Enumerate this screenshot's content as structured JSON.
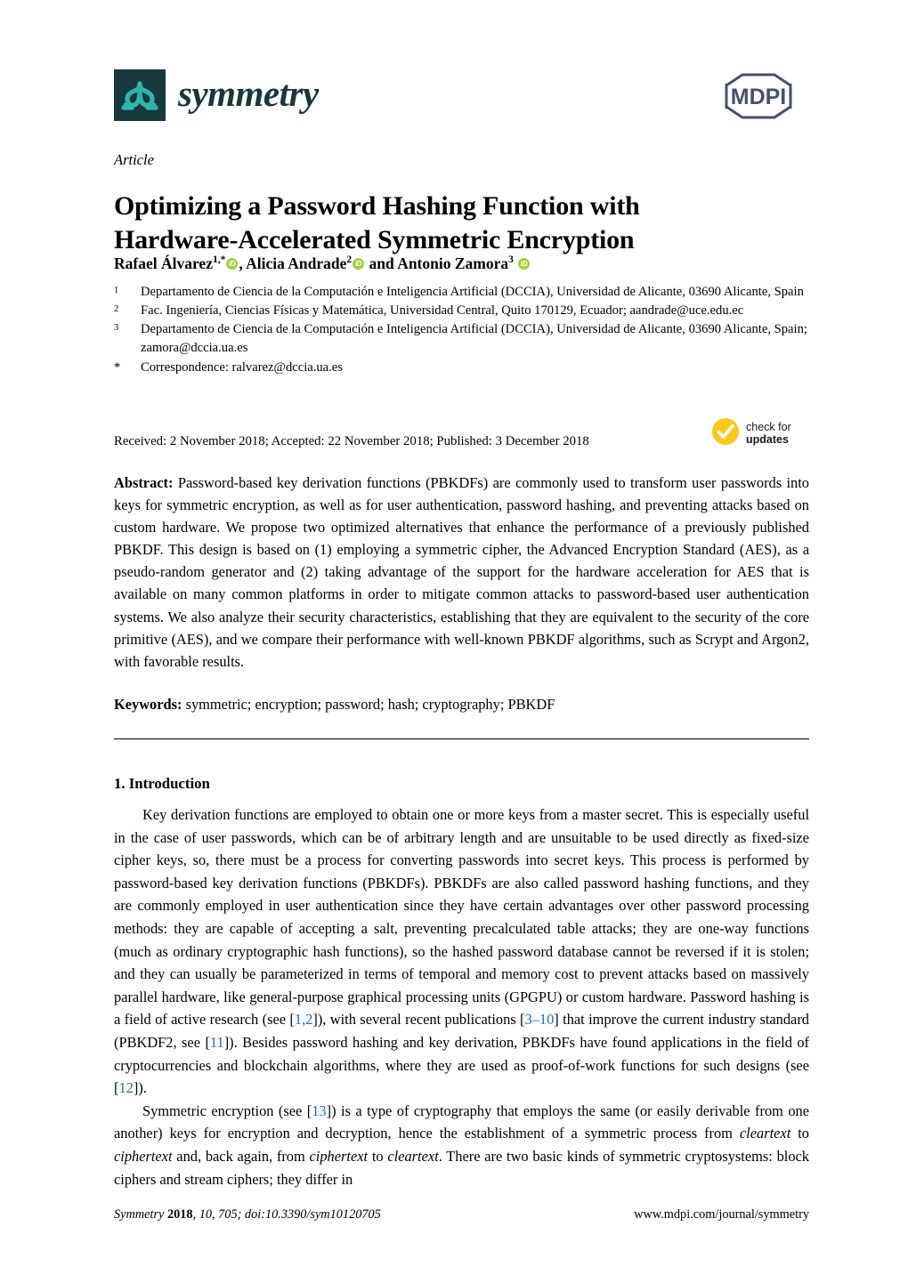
{
  "journal": {
    "name": "symmetry",
    "logo_icon": "symmetry-logo-icon",
    "publisher_logo_text": "MDPI",
    "logo_colors": {
      "box": "#17393d",
      "glyph": "#2eb5ad",
      "mdpi": "#46506e"
    }
  },
  "article": {
    "type": "Article",
    "title": "Optimizing a Password Hashing Function with Hardware-Accelerated Symmetric Encryption"
  },
  "authors": {
    "list": [
      {
        "name": "Rafael Álvarez",
        "markers": "1,*",
        "orcid": "iD"
      },
      {
        "name": "Alicia Andrade",
        "markers": "2",
        "orcid": "iD"
      },
      {
        "name": "Antonio Zamora",
        "markers": "3",
        "orcid": "iD"
      }
    ],
    "conjunction": "and",
    "separator": ", "
  },
  "affiliations": [
    {
      "marker": "1",
      "text": "Departamento de Ciencia de la Computación e Inteligencia Artificial (DCCIA), Universidad de Alicante, 03690 Alicante, Spain"
    },
    {
      "marker": "2",
      "text": "Fac. Ingeniería, Ciencias Físicas y Matemática, Universidad Central, Quito 170129, Ecuador; aandrade@uce.edu.ec"
    },
    {
      "marker": "3",
      "text": "Departamento de Ciencia de la Computación e Inteligencia Artificial (DCCIA), Universidad de Alicante, 03690 Alicante, Spain; zamora@dccia.ua.es"
    },
    {
      "marker": "*",
      "text": "Correspondence: ralvarez@dccia.ua.es"
    }
  ],
  "dates": {
    "line": "Received: 2 November 2018; Accepted: 22 November 2018; Published: 3 December 2018"
  },
  "crossmark": {
    "icon": "check-circle-icon",
    "line1": "check for",
    "line2": "updates",
    "color": "#fbc91b"
  },
  "abstract": {
    "label": "Abstract:",
    "text": "Password-based key derivation functions (PBKDFs) are commonly used to transform user passwords into keys for symmetric encryption, as well as for user authentication, password hashing, and preventing attacks based on custom hardware. We propose two optimized alternatives that enhance the performance of a previously published PBKDF. This design is based on (1) employing a symmetric cipher, the Advanced Encryption Standard (AES), as a pseudo-random generator and (2) taking advantage of the support for the hardware acceleration for AES that is available on many common platforms in order to mitigate common attacks to password-based user authentication systems. We also analyze their security characteristics, establishing that they are equivalent to the security of the core primitive (AES), and we compare their performance with well-known PBKDF algorithms, such as Scrypt and Argon2, with favorable results."
  },
  "keywords": {
    "label": "Keywords:",
    "text": "symmetric; encryption; password; hash; cryptography; PBKDF"
  },
  "body": {
    "section_heading": "1. Introduction",
    "paragraph_1_a": "Key derivation functions are employed to obtain one or more keys from a master secret. This is especially useful in the case of user passwords, which can be of arbitrary length and are unsuitable to be used directly as fixed-size cipher keys, so, there must be a process for converting passwords into secret keys. This process is performed by password-based key derivation functions (PBKDFs). PBKDFs are also called password hashing functions, and they are commonly employed in user authentication since they have certain advantages over other password processing methods: they are capable of accepting a salt, preventing precalculated table attacks; they are one-way functions (much as ordinary cryptographic hash functions), so the hashed password database cannot be reversed if it is stolen; and they can usually be parameterized in terms of temporal and memory cost to prevent attacks based on massively parallel hardware, like general-purpose graphical processing units (GPGPU) or custom hardware. Password hashing is a field of active research (see [",
    "cite_1": "1,2",
    "paragraph_1_b": "]), with several recent publications [",
    "cite_2": "3–10",
    "paragraph_1_c": "] that improve the current industry standard (PBKDF2, see [",
    "cite_3": "11",
    "paragraph_1_d": "]). Besides password hashing and key derivation, PBKDFs have found applications in the field of cryptocurrencies and blockchain algorithms, where they are used as proof-of-work functions for such designs (see [",
    "cite_4": "12",
    "paragraph_1_e": "]).",
    "paragraph_2_a": "Symmetric encryption (see [",
    "cite_5": "13",
    "paragraph_2_b": "]) is a type of cryptography that employs the same (or easily derivable from one another) keys for encryption and decryption, hence the establishment of a symmetric process from ",
    "italic_1": "cleartext",
    "paragraph_2_c": " to ",
    "italic_2": "ciphertext",
    "paragraph_2_d": " and, back again, from ",
    "italic_3": "ciphertext",
    "paragraph_2_e": " to ",
    "italic_4": "cleartext",
    "paragraph_2_f": ". There are two basic kinds of symmetric cryptosystems: block ciphers and stream ciphers; they differ in"
  },
  "footer": {
    "journal_italic": "Symmetry",
    "year": "2018",
    "volume_issue": ", 10, 705; doi:10.3390/sym10120705",
    "url": "www.mdpi.com/journal/symmetry"
  }
}
